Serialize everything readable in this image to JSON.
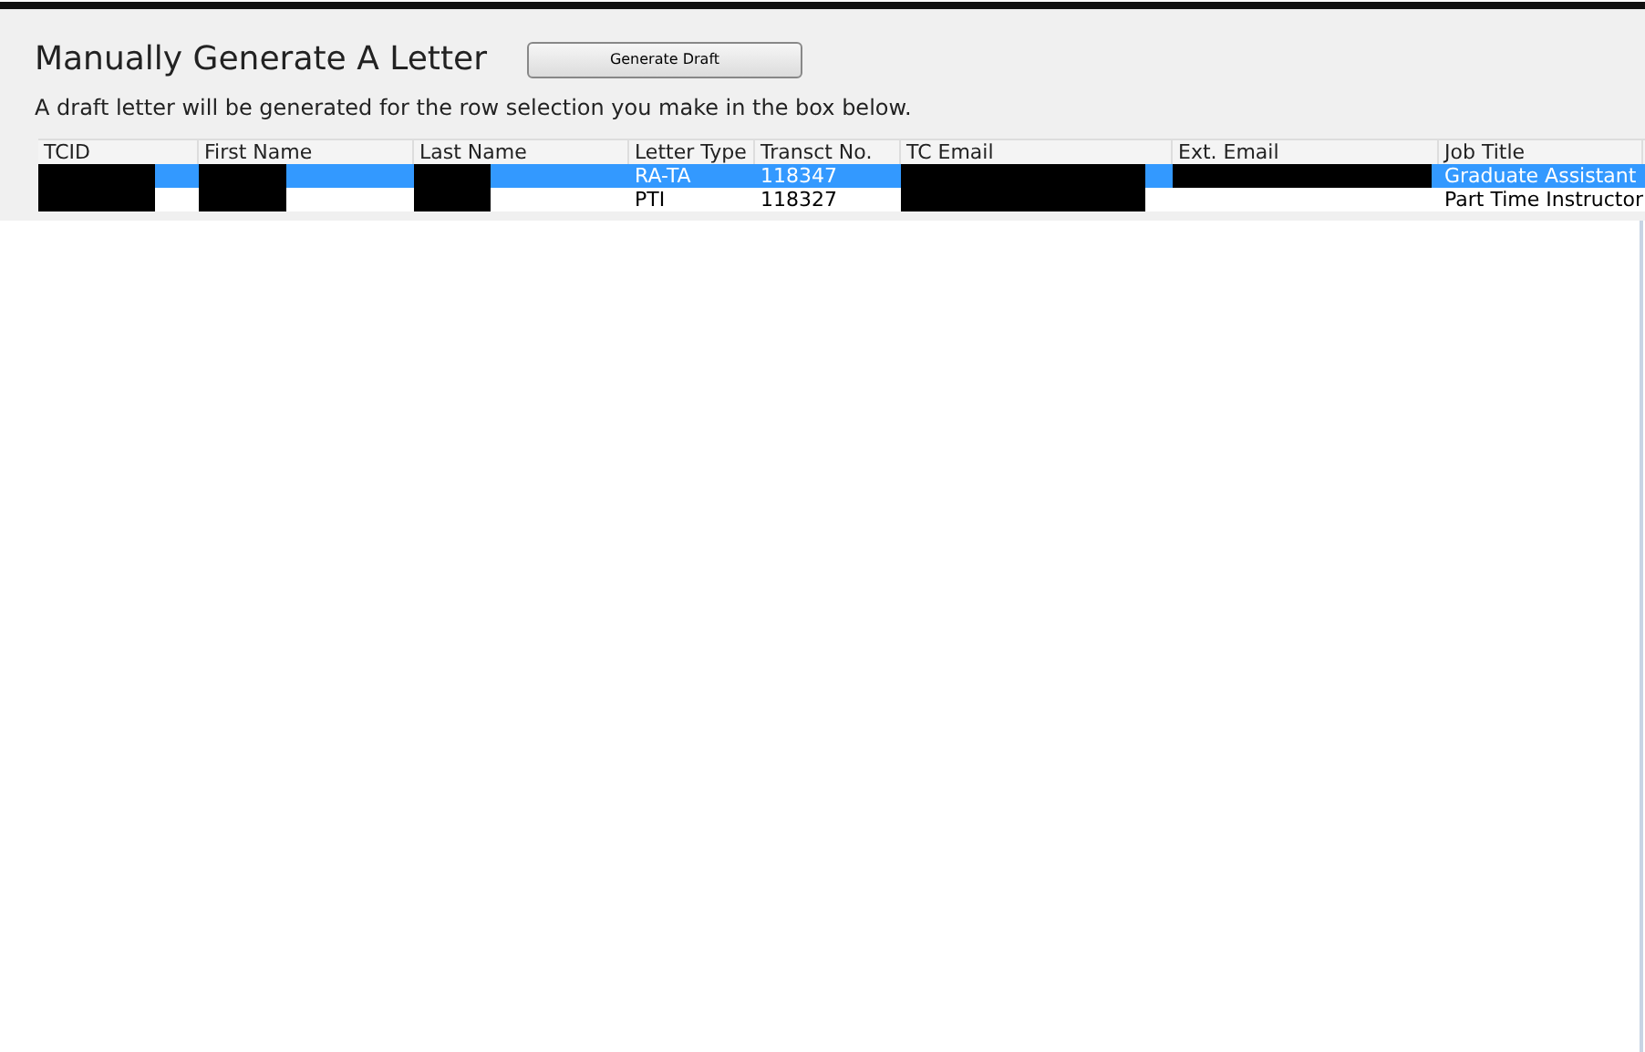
{
  "title": "Manually Generate A Letter",
  "generate_button": "Generate Draft",
  "instructions": "A draft letter will be generated for the row selection you make in the box below.",
  "table": {
    "columns": [
      "TCID",
      "First Name",
      "Last Name",
      "Letter Type",
      "Transct No.",
      "TC Email",
      "Ext. Email",
      "Job Title"
    ],
    "rows": [
      {
        "selected": true,
        "cells": [
          {
            "redacted": true
          },
          {
            "redacted": true
          },
          {
            "redacted": true
          },
          {
            "text": "RA-TA"
          },
          {
            "text": "118347"
          },
          {
            "redacted": true
          },
          {
            "redacted": true
          },
          {
            "text": "Graduate Assistant"
          }
        ]
      },
      {
        "selected": false,
        "cells": [
          {
            "redacted": true
          },
          {
            "redacted": true
          },
          {
            "redacted": true
          },
          {
            "text": "PTI"
          },
          {
            "text": "118327"
          },
          {
            "redacted": true
          },
          {},
          {
            "text": "Part Time Instructor"
          }
        ]
      }
    ]
  }
}
